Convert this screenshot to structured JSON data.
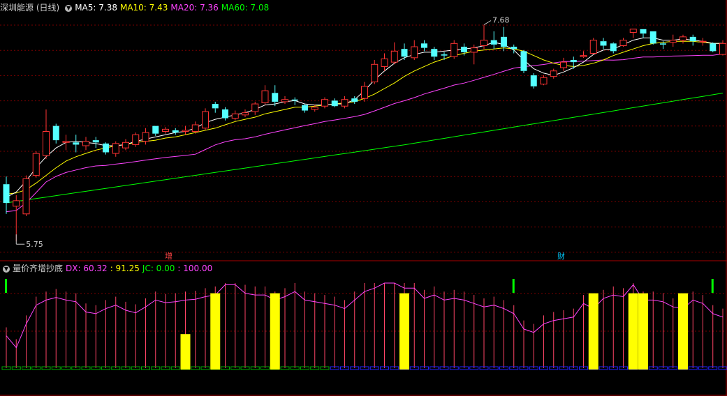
{
  "main_panel": {
    "title": "深圳能源 (日线)",
    "indicators": [
      {
        "label": "MA5: 7.38",
        "color": "#ffffff"
      },
      {
        "label": "MA10: 7.43",
        "color": "#ffff00"
      },
      {
        "label": "MA20: 7.36",
        "color": "#ff44ff"
      },
      {
        "label": "MA60: 7.08",
        "color": "#00ff00"
      }
    ],
    "high_label": "7.68",
    "low_label": "5.75",
    "event_markers": [
      {
        "text": "增",
        "color": "#ff4444"
      },
      {
        "text": "财",
        "color": "#00ccff"
      }
    ]
  },
  "sub_panel": {
    "title": "量价齐增抄底",
    "indicators": [
      {
        "label": "DX: 60.32",
        "color": "#ff44ff"
      },
      {
        "label": ": 91.25",
        "color": "#ffff00"
      },
      {
        "label": "JC: 0.00",
        "color": "#00ff00"
      },
      {
        "label": ": 100.00",
        "color": "#ff44ff"
      }
    ]
  },
  "colors": {
    "up": "#ff3333",
    "down": "#54ffff",
    "grid": "#7a0000",
    "ma5": "#ffffff",
    "ma10": "#ffff00",
    "ma20": "#ff44ff",
    "ma60": "#00ff00",
    "signal": "#ffff00",
    "jc": "#00ff00"
  },
  "chart_data": [
    {
      "type": "candlestick",
      "title": "深圳能源 (日线)",
      "ylim": [
        5.65,
        7.85
      ],
      "candles": [
        [
          6.27,
          6.1,
          6.34,
          6.0
        ],
        [
          6.07,
          6.12,
          6.17,
          5.75
        ],
        [
          6.0,
          6.32,
          6.35,
          5.98
        ],
        [
          6.35,
          6.55,
          6.57,
          6.33
        ],
        [
          6.53,
          6.75,
          6.95,
          6.5
        ],
        [
          6.8,
          6.67,
          6.82,
          6.64
        ],
        [
          6.65,
          6.66,
          6.72,
          6.58
        ],
        [
          6.65,
          6.63,
          6.72,
          6.56
        ],
        [
          6.62,
          6.66,
          6.7,
          6.58
        ],
        [
          6.67,
          6.65,
          6.7,
          6.6
        ],
        [
          6.64,
          6.56,
          6.65,
          6.54
        ],
        [
          6.55,
          6.64,
          6.66,
          6.52
        ],
        [
          6.6,
          6.65,
          6.68,
          6.58
        ],
        [
          6.63,
          6.72,
          6.74,
          6.61
        ],
        [
          6.66,
          6.74,
          6.78,
          6.63
        ],
        [
          6.8,
          6.73,
          6.8,
          6.71
        ],
        [
          6.75,
          6.77,
          6.79,
          6.73
        ],
        [
          6.76,
          6.74,
          6.78,
          6.72
        ],
        [
          6.75,
          6.76,
          6.8,
          6.72
        ],
        [
          6.75,
          6.81,
          6.84,
          6.73
        ],
        [
          6.78,
          6.93,
          6.96,
          6.76
        ],
        [
          7.0,
          6.96,
          7.02,
          6.92
        ],
        [
          6.95,
          6.87,
          6.97,
          6.85
        ],
        [
          6.87,
          6.91,
          6.94,
          6.85
        ],
        [
          6.9,
          6.92,
          6.95,
          6.88
        ],
        [
          6.93,
          7.0,
          7.02,
          6.9
        ],
        [
          7.01,
          7.12,
          7.17,
          6.99
        ],
        [
          7.1,
          7.02,
          7.17,
          6.98
        ],
        [
          7.02,
          7.04,
          7.07,
          7.0
        ],
        [
          7.04,
          7.03,
          7.06,
          6.99
        ],
        [
          6.99,
          6.94,
          7.0,
          6.92
        ],
        [
          6.95,
          6.97,
          6.99,
          6.93
        ],
        [
          6.98,
          7.04,
          7.06,
          6.96
        ],
        [
          7.03,
          6.98,
          7.05,
          6.97
        ],
        [
          6.98,
          7.04,
          7.07,
          6.96
        ],
        [
          7.05,
          7.02,
          7.07,
          7.0
        ],
        [
          7.05,
          7.16,
          7.2,
          7.02
        ],
        [
          7.2,
          7.36,
          7.4,
          7.18
        ],
        [
          7.34,
          7.41,
          7.46,
          7.3
        ],
        [
          7.38,
          7.48,
          7.56,
          7.36
        ],
        [
          7.5,
          7.43,
          7.55,
          7.4
        ],
        [
          7.42,
          7.52,
          7.58,
          7.4
        ],
        [
          7.55,
          7.51,
          7.58,
          7.48
        ],
        [
          7.5,
          7.43,
          7.52,
          7.4
        ],
        [
          7.45,
          7.44,
          7.47,
          7.4
        ],
        [
          7.43,
          7.55,
          7.58,
          7.41
        ],
        [
          7.52,
          7.47,
          7.55,
          7.44
        ],
        [
          7.47,
          7.51,
          7.54,
          7.36
        ],
        [
          7.53,
          7.58,
          7.72,
          7.5
        ],
        [
          7.58,
          7.54,
          7.66,
          7.5
        ],
        [
          7.61,
          7.52,
          7.7,
          7.48
        ],
        [
          7.52,
          7.5,
          7.54,
          7.46
        ],
        [
          7.48,
          7.3,
          7.49,
          7.28
        ],
        [
          7.26,
          7.16,
          7.28,
          7.14
        ],
        [
          7.18,
          7.24,
          7.26,
          7.17
        ],
        [
          7.25,
          7.3,
          7.32,
          7.23
        ],
        [
          7.33,
          7.38,
          7.42,
          7.3
        ],
        [
          7.4,
          7.38,
          7.43,
          7.32
        ],
        [
          7.43,
          7.44,
          7.48,
          7.42
        ],
        [
          7.46,
          7.58,
          7.6,
          7.45
        ],
        [
          7.57,
          7.53,
          7.6,
          7.5
        ],
        [
          7.55,
          7.48,
          7.56,
          7.46
        ],
        [
          7.53,
          7.58,
          7.6,
          7.52
        ],
        [
          7.65,
          7.68,
          7.68,
          7.6
        ],
        [
          7.68,
          7.64,
          7.68,
          7.6
        ],
        [
          7.66,
          7.55,
          7.66,
          7.54
        ],
        [
          7.55,
          7.54,
          7.57,
          7.5
        ],
        [
          7.56,
          7.58,
          7.63,
          7.52
        ],
        [
          7.58,
          7.61,
          7.63,
          7.55
        ],
        [
          7.61,
          7.57,
          7.63,
          7.53
        ],
        [
          7.57,
          7.57,
          7.6,
          7.53
        ],
        [
          7.55,
          7.48,
          7.56,
          7.47
        ],
        [
          7.45,
          7.55,
          7.58,
          7.44
        ]
      ],
      "ma5": [
        6.15,
        6.2,
        6.3,
        6.42,
        6.52,
        6.6,
        6.65,
        6.66,
        6.65,
        6.64,
        6.62,
        6.62,
        6.63,
        6.66,
        6.68,
        6.7,
        6.72,
        6.74,
        6.75,
        6.78,
        6.83,
        6.86,
        6.88,
        6.9,
        6.92,
        6.95,
        6.99,
        7.0,
        7.02,
        7.03,
        7.0,
        6.99,
        6.99,
        7.0,
        7.0,
        7.04,
        7.12,
        7.22,
        7.3,
        7.37,
        7.42,
        7.45,
        7.47,
        7.47,
        7.48,
        7.49,
        7.5,
        7.51,
        7.53,
        7.56,
        7.54,
        7.49,
        7.4,
        7.32,
        7.28,
        7.26,
        7.29,
        7.33,
        7.38,
        7.45,
        7.49,
        7.5,
        7.54,
        7.58,
        7.6,
        7.6,
        7.58,
        7.58,
        7.59,
        7.58,
        7.57,
        7.55,
        7.55
      ],
      "ma10": [
        6.18,
        6.19,
        6.22,
        6.28,
        6.35,
        6.42,
        6.48,
        6.52,
        6.55,
        6.58,
        6.6,
        6.62,
        6.63,
        6.65,
        6.66,
        6.67,
        6.69,
        6.7,
        6.72,
        6.74,
        6.76,
        6.78,
        6.81,
        6.84,
        6.86,
        6.88,
        6.91,
        6.93,
        6.95,
        6.97,
        6.97,
        6.98,
        6.99,
        7.0,
        7.01,
        7.02,
        7.05,
        7.09,
        7.14,
        7.19,
        7.25,
        7.3,
        7.34,
        7.38,
        7.41,
        7.44,
        7.46,
        7.48,
        7.49,
        7.5,
        7.51,
        7.5,
        7.48,
        7.44,
        7.4,
        7.37,
        7.35,
        7.34,
        7.35,
        7.37,
        7.4,
        7.44,
        7.47,
        7.5,
        7.53,
        7.55,
        7.56,
        7.57,
        7.57,
        7.57,
        7.56,
        7.55,
        7.55
      ]
    }
  ]
}
